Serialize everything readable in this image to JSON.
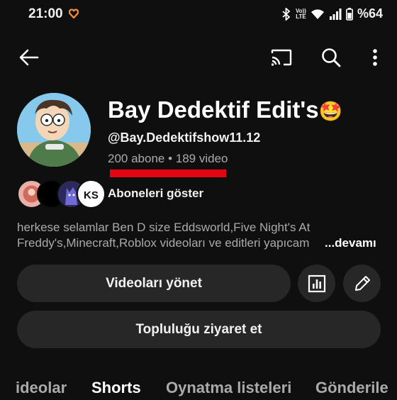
{
  "status_bar": {
    "time": "21:00",
    "volte_top": "Vo))",
    "volte_bottom": "LTE",
    "battery": "%64"
  },
  "app_bar": {
    "back_icon": "arrow-left-icon",
    "cast_icon": "cast-icon",
    "search_icon": "search-icon",
    "more_icon": "more-vert-icon"
  },
  "channel": {
    "name": "Bay Dedektif Edit's",
    "name_emoji": "🤩",
    "handle": "@Bay.Dedektifshow11.12",
    "stats": "200 abone • 189 video",
    "show_subscribers": "Aboneleri göster",
    "description": "herkese selamlar Ben D size Eddsworld,Five Night's At Freddy's,Minecraft,Roblox videoları ve editleri yapıcam",
    "more": "...devamı"
  },
  "actions": {
    "manage_videos": "Videoları yönet",
    "visit_community": "Topluluğu ziyaret et",
    "analytics_icon": "analytics-icon",
    "edit_icon": "pencil-icon"
  },
  "tabs": [
    "ideolar",
    "Shorts",
    "Oynatma listeleri",
    "Gönderile"
  ],
  "colors": {
    "background": "#0f0f0f",
    "button": "#272727",
    "secondary_text": "#aaaaaa",
    "annotation_red": "#e10612"
  }
}
